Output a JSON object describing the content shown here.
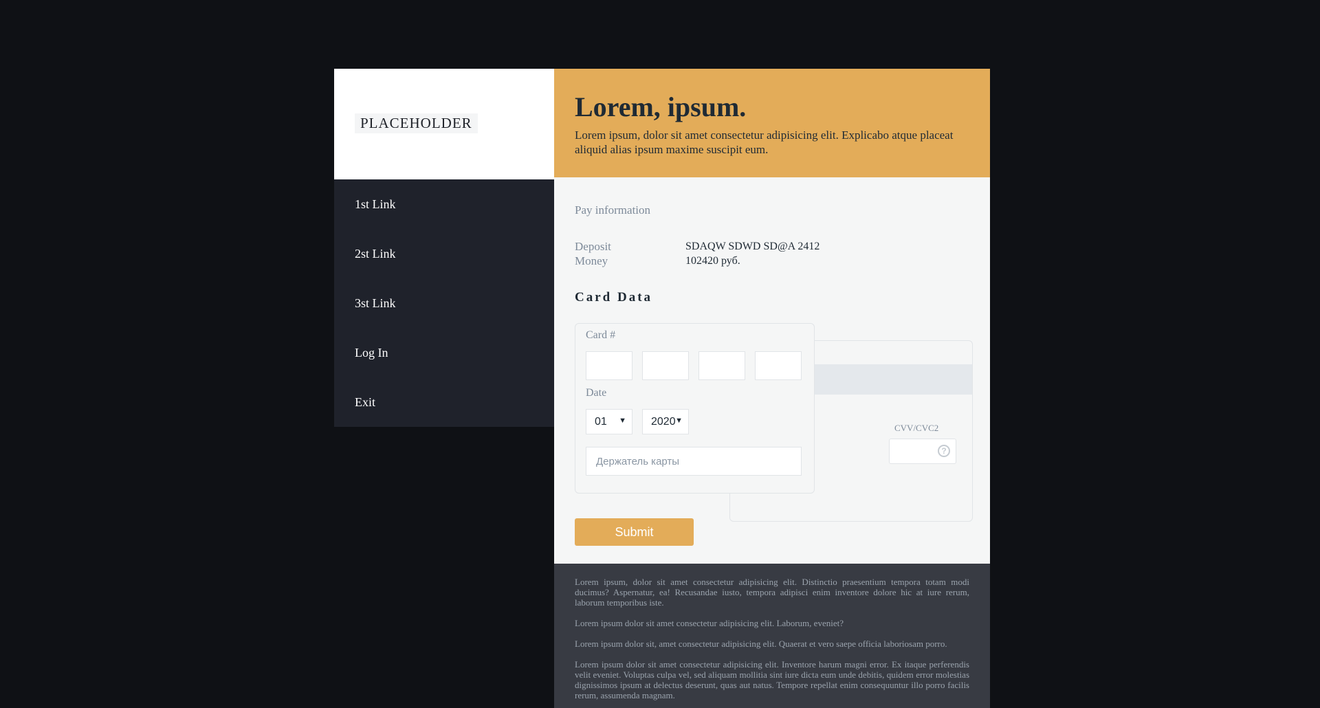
{
  "sidebar": {
    "logo": "PLACEHOLDER",
    "items": [
      {
        "label": "1st Link"
      },
      {
        "label": "2st Link"
      },
      {
        "label": "3st Link"
      },
      {
        "label": "Log In"
      },
      {
        "label": "Exit"
      }
    ]
  },
  "hero": {
    "title": "Lorem, ipsum.",
    "subtitle": "Lorem ipsum, dolor sit amet consectetur adipisicing elit. Explicabo atque placeat aliquid alias ipsum maxime suscipit eum."
  },
  "pay": {
    "title": "Pay information",
    "deposit_label": "Deposit",
    "deposit_value": "SDAQW SDWD SD@A 2412",
    "money_label": "Money",
    "money_value": "102420 руб."
  },
  "card": {
    "heading": "Card Data",
    "number_label": "Card #",
    "date_label": "Date",
    "month": "01",
    "year": "2020",
    "holder_placeholder": "Держатель карты",
    "cvv_label": "CVV/CVC2",
    "help_icon": "?"
  },
  "submit_label": "Submit",
  "footer": {
    "paragraphs": [
      "Lorem ipsum, dolor sit amet consectetur adipisicing elit. Distinctio praesentium tempora totam modi ducimus? Aspernatur, ea! Recusandae iusto, tempora adipisci enim inventore dolore hic at iure rerum, laborum temporibus iste.",
      "Lorem ipsum dolor sit amet consectetur adipisicing elit. Laborum, eveniet?",
      "Lorem ipsum dolor sit, amet consectetur adipisicing elit. Quaerat et vero saepe officia laboriosam porro.",
      "Lorem ipsum dolor sit amet consectetur adipisicing elit. Inventore harum magni error. Ex itaque perferendis velit eveniet. Voluptas culpa vel, sed aliquam mollitia sint iure dicta eum unde debitis, quidem error molestias dignissimos ipsum at delectus deserunt, quas aut natus. Tempore repellat enim consequuntur illo porro facilis rerum, assumenda magnam."
    ]
  },
  "colors": {
    "accent": "#e3ac59",
    "sidebar_bg": "#1f222b",
    "page_bg": "#0f1115",
    "footer_bg": "#383b43"
  }
}
